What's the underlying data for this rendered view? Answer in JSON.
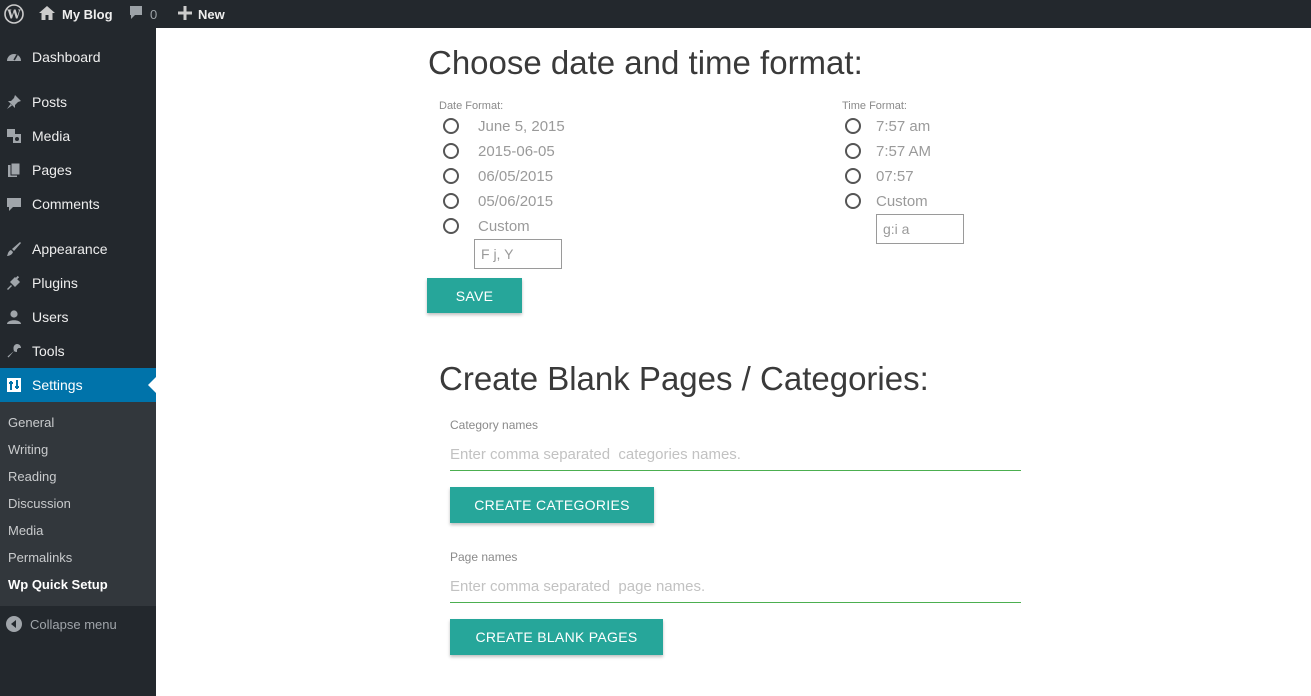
{
  "adminbar": {
    "site_name": "My Blog",
    "comments_count": "0",
    "new_label": "New"
  },
  "sidebar": {
    "items": [
      {
        "label": "Dashboard",
        "icon": "dashboard-icon"
      },
      {
        "label": "Posts",
        "icon": "pin-icon"
      },
      {
        "label": "Media",
        "icon": "media-icon"
      },
      {
        "label": "Pages",
        "icon": "pages-icon"
      },
      {
        "label": "Comments",
        "icon": "comment-icon"
      },
      {
        "label": "Appearance",
        "icon": "brush-icon"
      },
      {
        "label": "Plugins",
        "icon": "plugin-icon"
      },
      {
        "label": "Users",
        "icon": "user-icon"
      },
      {
        "label": "Tools",
        "icon": "wrench-icon"
      },
      {
        "label": "Settings",
        "icon": "settings-icon"
      }
    ],
    "submenu": [
      "General",
      "Writing",
      "Reading",
      "Discussion",
      "Media",
      "Permalinks",
      "Wp Quick Setup"
    ],
    "collapse_label": "Collapse menu"
  },
  "date_time": {
    "title": "Choose date and time format:",
    "date_label": "Date Format:",
    "date_options": [
      "June 5, 2015",
      "2015-06-05",
      "06/05/2015",
      "05/06/2015",
      "Custom"
    ],
    "date_custom_placeholder": "F j, Y",
    "time_label": "Time Format:",
    "time_options": [
      "7:57 am",
      "7:57 AM",
      "07:57",
      "Custom"
    ],
    "time_custom_placeholder": "g:i a",
    "save_label": "SAVE"
  },
  "blank": {
    "title": "Create Blank Pages / Categories:",
    "category_label": "Category names",
    "category_placeholder": "Enter comma separated  categories names.",
    "create_categories_label": "CREATE CATEGORIES",
    "page_label": "Page names",
    "page_placeholder": "Enter comma separated  page names.",
    "create_pages_label": "CREATE BLANK PAGES"
  },
  "colors": {
    "adminbar_bg": "#23282d",
    "submenu_bg": "#32373c",
    "active_bg": "#0073aa",
    "button_bg": "#26a69a",
    "input_underline": "#4caf50"
  }
}
